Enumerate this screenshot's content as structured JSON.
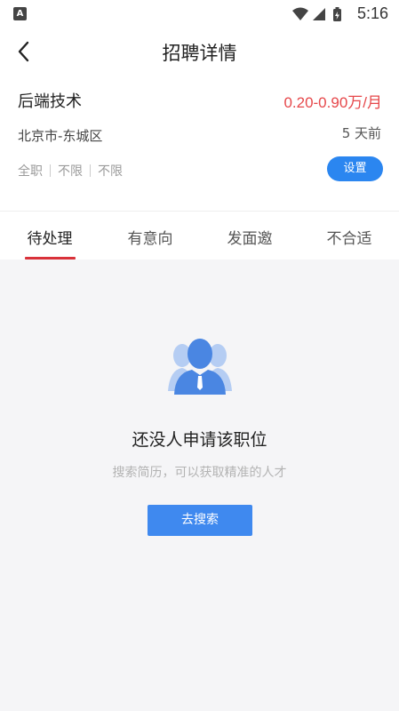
{
  "status_bar": {
    "app_badge": "A",
    "time": "5:16",
    "icons": [
      "wifi-icon",
      "signal-icon",
      "battery-icon"
    ]
  },
  "header": {
    "title": "招聘详情",
    "back_icon": "chevron-left-icon"
  },
  "job": {
    "name": "后端技术",
    "salary": "0.20-0.90万/月",
    "location": "北京市-东城区",
    "posted": "5 天前",
    "tags": [
      "全职",
      "不限",
      "不限"
    ],
    "settings_label": "设置"
  },
  "tabs": [
    {
      "label": "待处理",
      "active": true
    },
    {
      "label": "有意向",
      "active": false
    },
    {
      "label": "发面邀",
      "active": false
    },
    {
      "label": "不合适",
      "active": false
    }
  ],
  "empty_state": {
    "icon": "person-group-icon",
    "title": "还没人申请该职位",
    "subtitle": "搜索简历，可以获取精准的人才",
    "button_label": "去搜索"
  },
  "colors": {
    "accent_blue": "#2b86f0",
    "salary_red": "#e6474a",
    "tab_underline": "#d9323a",
    "background": "#f5f5f7"
  }
}
